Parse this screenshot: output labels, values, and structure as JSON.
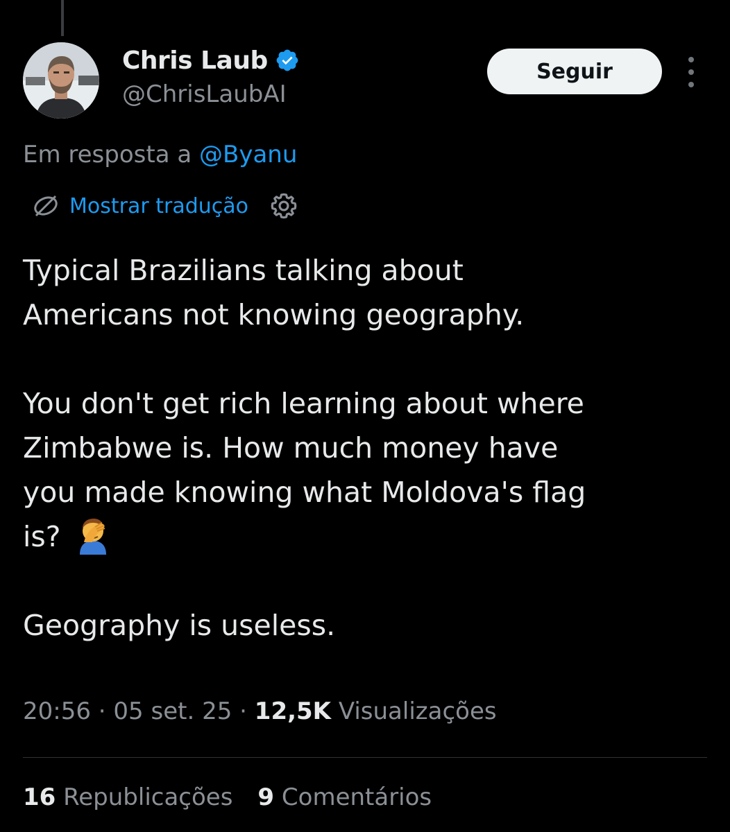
{
  "author": {
    "display_name": "Chris Laub",
    "handle": "@ChrisLaubAI",
    "verified": true,
    "verified_color": "#1d9bf0"
  },
  "follow_button": {
    "label": "Seguir"
  },
  "reply_context": {
    "prefix": "Em resposta a",
    "mention": "@Byanu"
  },
  "translation": {
    "link_label": "Mostrar tradução"
  },
  "tweet": {
    "paragraph1": [
      "Typical Brazilians talking about",
      "Americans not knowing geography."
    ],
    "paragraph2": [
      "You don't get rich learning about where",
      "Zimbabwe is. How much money have",
      "you made knowing what Moldova's flag",
      "is?"
    ],
    "paragraph3": [
      "Geography is useless."
    ],
    "emoji": "facepalm-emoji"
  },
  "meta": {
    "time": "20:56",
    "date": "05 set. 25",
    "separator": "·",
    "views_count": "12,5K",
    "views_label": "Visualizações"
  },
  "stats": {
    "reposts_count": "16",
    "reposts_label": "Republicações",
    "comments_count": "9",
    "comments_label": "Comentários"
  },
  "colors": {
    "background": "#000000",
    "text_primary": "#e7e9ea",
    "text_secondary": "#8b9096",
    "link": "#1d9bf0",
    "button_bg": "#eff3f4"
  }
}
